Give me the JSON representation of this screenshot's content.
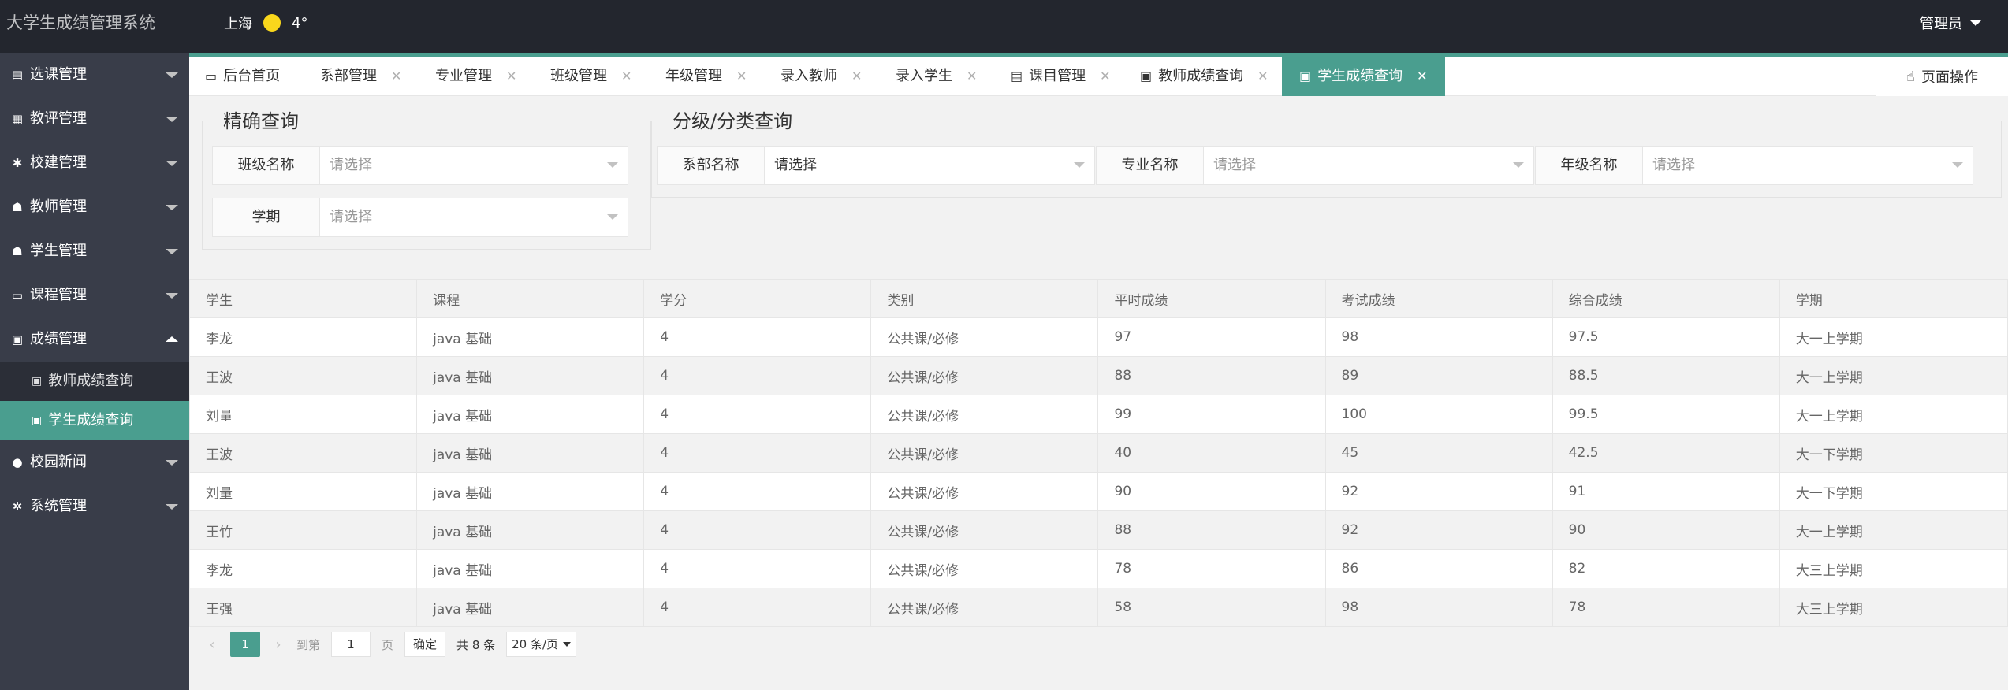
{
  "header": {
    "title": "大学生成绩管理系统",
    "city": "上海",
    "temperature": "4°",
    "user": "管理员"
  },
  "sidebar": {
    "items": [
      {
        "label": "选课管理",
        "icon": "document-icon"
      },
      {
        "label": "教评管理",
        "icon": "grid-icon"
      },
      {
        "label": "校建管理",
        "icon": "tool-icon"
      },
      {
        "label": "教师管理",
        "icon": "users-icon"
      },
      {
        "label": "学生管理",
        "icon": "users-icon"
      },
      {
        "label": "课程管理",
        "icon": "book-icon"
      },
      {
        "label": "成绩管理",
        "icon": "clipboard-icon"
      },
      {
        "label": "校园新闻",
        "icon": "chat-icon"
      },
      {
        "label": "系统管理",
        "icon": "settings-icon"
      }
    ],
    "sub_items": [
      {
        "label": "教师成绩查询",
        "icon": "clipboard-icon"
      },
      {
        "label": "学生成绩查询",
        "icon": "clipboard-icon"
      }
    ]
  },
  "tabs": [
    {
      "label": "后台首页",
      "icon": "monitor-icon"
    },
    {
      "label": "系部管理",
      "close": "✕"
    },
    {
      "label": "专业管理",
      "close": "✕"
    },
    {
      "label": "班级管理",
      "close": "✕"
    },
    {
      "label": "年级管理",
      "close": "✕"
    },
    {
      "label": "录入教师",
      "close": "✕"
    },
    {
      "label": "录入学生",
      "close": "✕"
    },
    {
      "label": "课目管理",
      "close": "✕",
      "icon": "document-icon"
    },
    {
      "label": "教师成绩查询",
      "close": "✕",
      "icon": "clipboard-icon"
    },
    {
      "label": "学生成绩查询",
      "close": "✕",
      "icon": "clipboard-icon"
    }
  ],
  "page_ops": "页面操作",
  "filters": {
    "exact_legend": "精确查询",
    "class_label": "班级名称",
    "class_placeholder": "请选择",
    "term_label": "学期",
    "term_placeholder": "请选择",
    "category_legend": "分级/分类查询",
    "dept_label": "系部名称",
    "dept_value": "请选择",
    "major_label": "专业名称",
    "major_placeholder": "请选择",
    "grade_label": "年级名称",
    "grade_placeholder": "请选择"
  },
  "table": {
    "columns": [
      "学生",
      "课程",
      "学分",
      "类别",
      "平时成绩",
      "考试成绩",
      "综合成绩",
      "学期"
    ],
    "rows": [
      [
        "李龙",
        "java 基础",
        "4",
        "公共课/必修",
        "97",
        "98",
        "97.5",
        "大一上学期"
      ],
      [
        "王波",
        "java 基础",
        "4",
        "公共课/必修",
        "88",
        "89",
        "88.5",
        "大一上学期"
      ],
      [
        "刘量",
        "java 基础",
        "4",
        "公共课/必修",
        "99",
        "100",
        "99.5",
        "大一上学期"
      ],
      [
        "王波",
        "java 基础",
        "4",
        "公共课/必修",
        "40",
        "45",
        "42.5",
        "大一下学期"
      ],
      [
        "刘量",
        "java 基础",
        "4",
        "公共课/必修",
        "90",
        "92",
        "91",
        "大一下学期"
      ],
      [
        "王竹",
        "java 基础",
        "4",
        "公共课/必修",
        "88",
        "92",
        "90",
        "大一上学期"
      ],
      [
        "李龙",
        "java 基础",
        "4",
        "公共课/必修",
        "78",
        "86",
        "82",
        "大三上学期"
      ],
      [
        "王强",
        "java 基础",
        "4",
        "公共课/必修",
        "58",
        "98",
        "78",
        "大三上学期"
      ]
    ]
  },
  "pagination": {
    "current_page": "1",
    "goto_prefix": "到第",
    "goto_value": "1",
    "goto_suffix": "页",
    "confirm": "确定",
    "total": "共 8 条",
    "page_size": "20 条/页"
  },
  "colors": {
    "accent": "#4a9e8f",
    "header_bg": "#23262e",
    "sidebar_bg": "#393d49"
  }
}
